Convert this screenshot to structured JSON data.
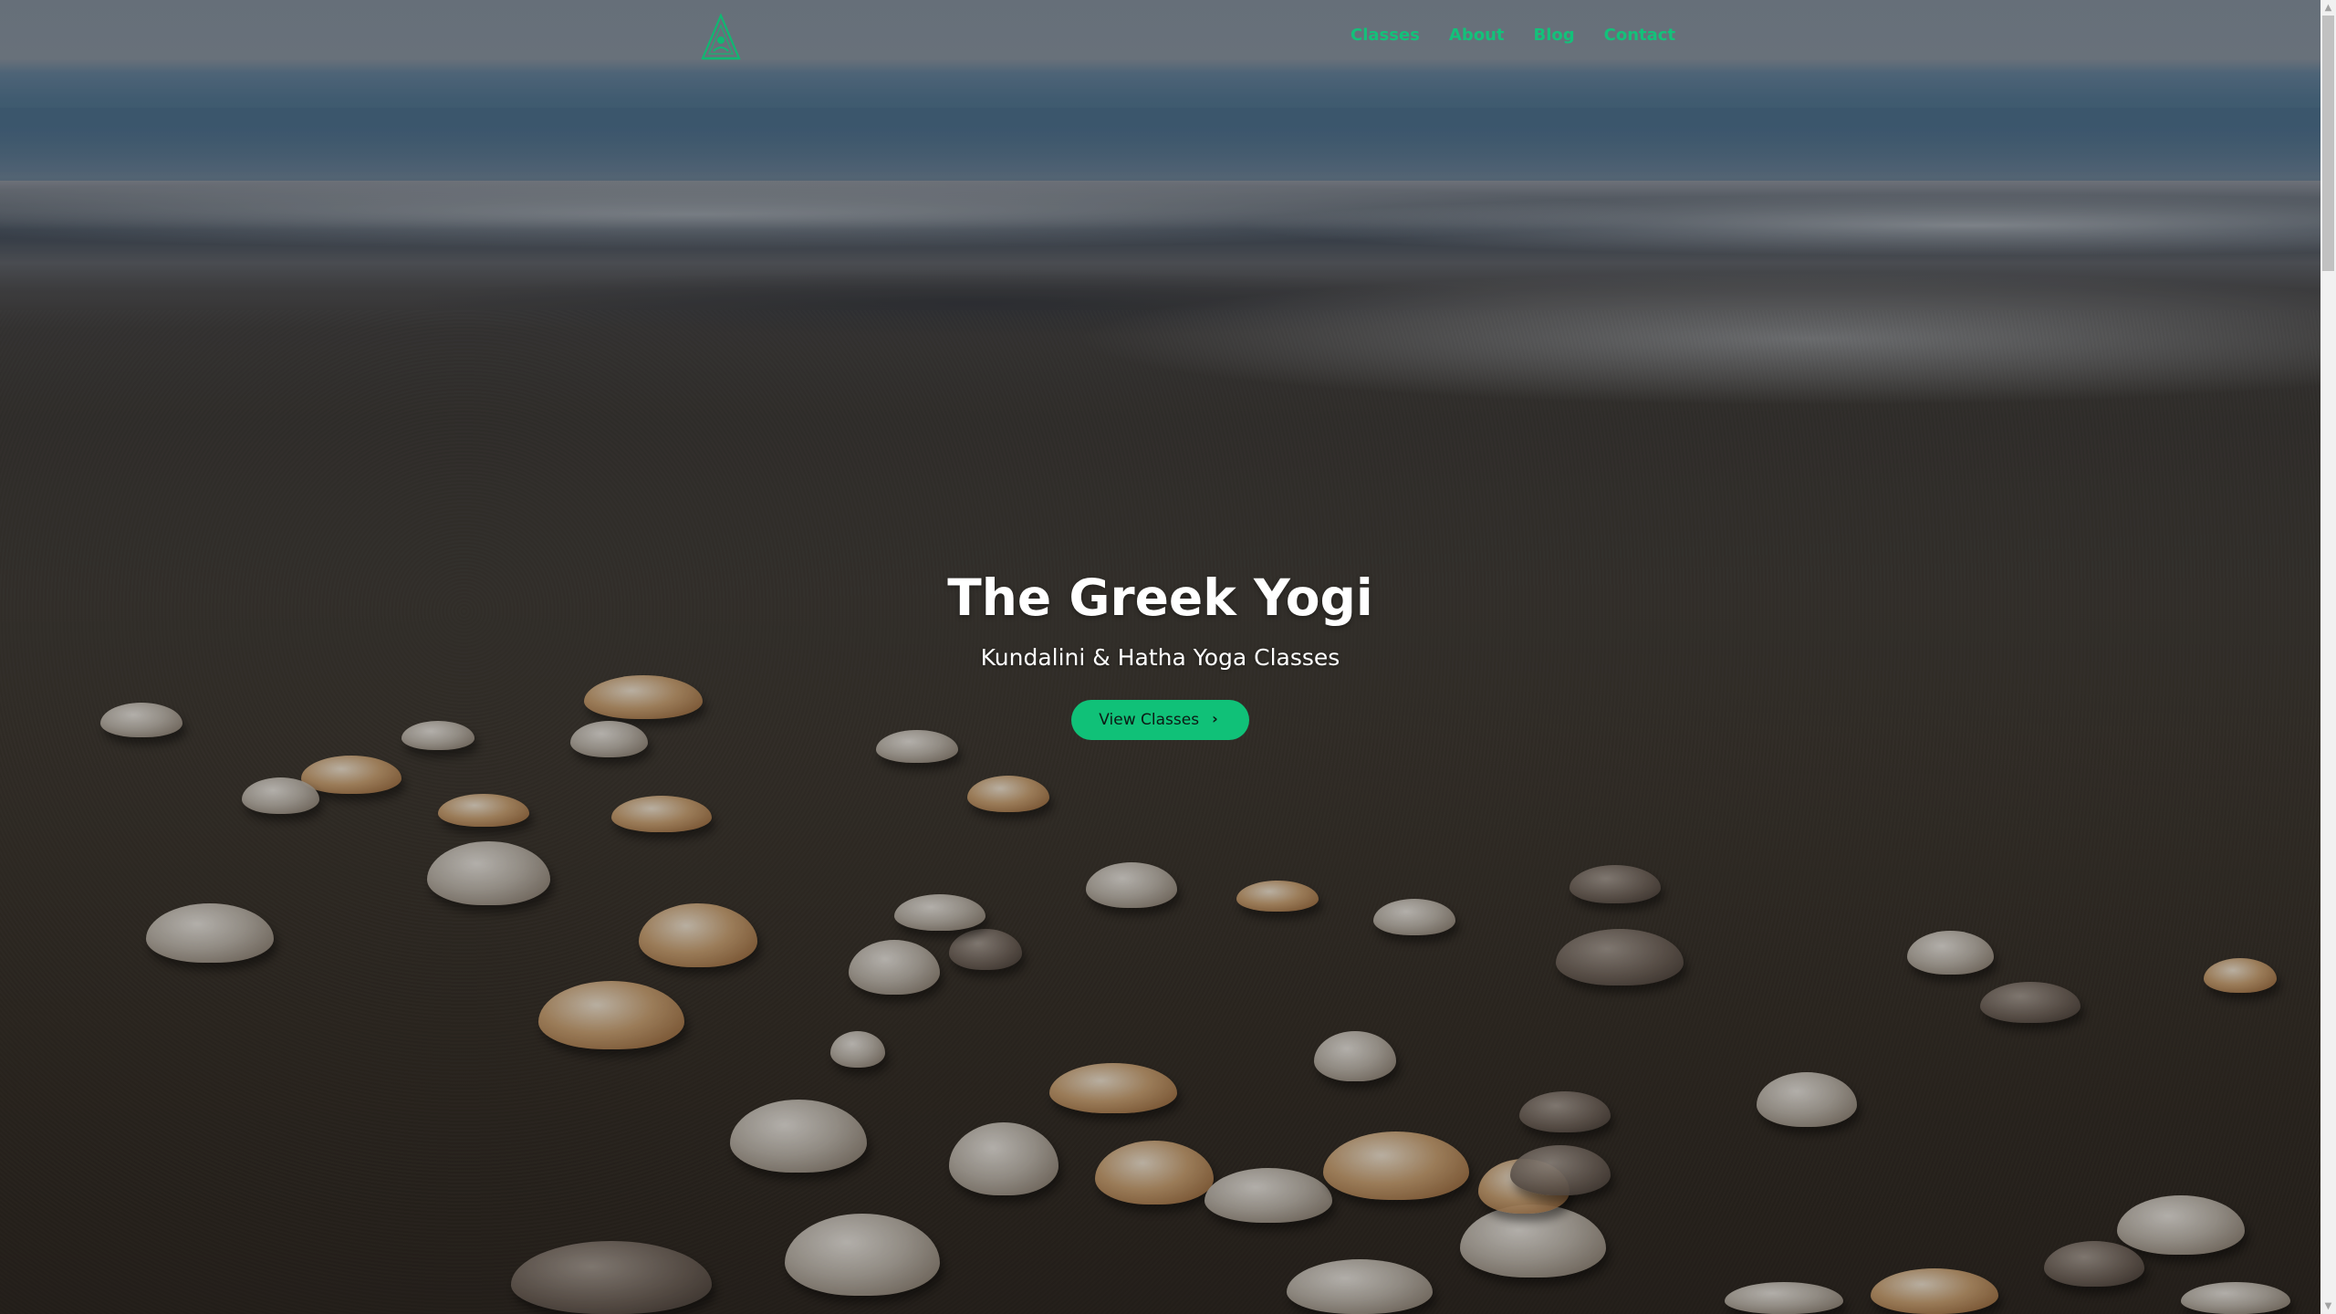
{
  "site": {
    "logo_icon": "yogi-pyramid-logo-icon"
  },
  "nav": {
    "items": [
      {
        "label": "Classes"
      },
      {
        "label": "About"
      },
      {
        "label": "Blog"
      },
      {
        "label": "Contact"
      }
    ]
  },
  "hero": {
    "title": "The Greek Yogi",
    "subtitle": "Kundalini & Hatha Yoga Classes",
    "cta_label": "View Classes",
    "cta_icon": "chevron-right-icon"
  },
  "colors": {
    "accent": "#13c17a",
    "button_bg": "#10c178",
    "text_light": "#ffffff"
  },
  "scrollbar": {
    "up_icon": "scroll-up-arrow-icon",
    "down_icon": "scroll-down-arrow-icon"
  }
}
